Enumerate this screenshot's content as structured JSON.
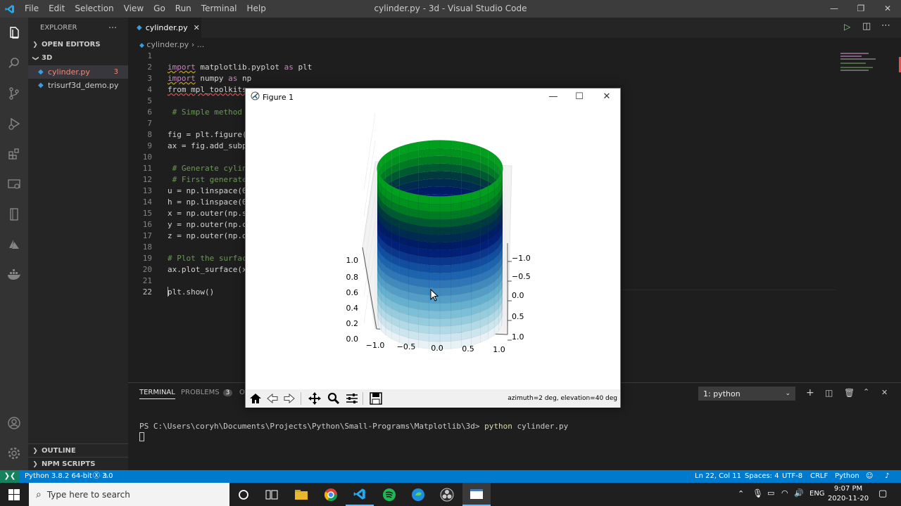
{
  "app": {
    "window_title": "cylinder.py - 3d - Visual Studio Code",
    "menu": [
      "File",
      "Edit",
      "Selection",
      "View",
      "Go",
      "Run",
      "Terminal",
      "Help"
    ]
  },
  "sidebar": {
    "title": "EXPLORER",
    "open_editors": "OPEN EDITORS",
    "folder": "3D",
    "files": [
      {
        "name": "cylinder.py",
        "problems": "3"
      },
      {
        "name": "trisurf3d_demo.py"
      }
    ],
    "outline": "OUTLINE",
    "npm_scripts": "NPM SCRIPTS"
  },
  "editor": {
    "tab_label": "cylinder.py",
    "breadcrumb_file": "cylinder.py",
    "breadcrumb_rest": "...",
    "lines": [
      {
        "n": "1",
        "t": ""
      },
      {
        "n": "2",
        "t": "import matplotlib.pyplot as plt"
      },
      {
        "n": "3",
        "t": "import numpy as np"
      },
      {
        "n": "4",
        "t": "from mpl_toolkits"
      },
      {
        "n": "5",
        "t": ""
      },
      {
        "n": "6",
        "t": " # Simple method"
      },
      {
        "n": "7",
        "t": ""
      },
      {
        "n": "8",
        "t": "fig = plt.figure("
      },
      {
        "n": "9",
        "t": "ax = fig.add_subp"
      },
      {
        "n": "10",
        "t": ""
      },
      {
        "n": "11",
        "t": " # Generate cylin"
      },
      {
        "n": "12",
        "t": " # First generate"
      },
      {
        "n": "13",
        "t": "u = np.linspace(0"
      },
      {
        "n": "14",
        "t": "h = np.linspace(0"
      },
      {
        "n": "15",
        "t": "x = np.outer(np.s"
      },
      {
        "n": "16",
        "t": "y = np.outer(np.c"
      },
      {
        "n": "17",
        "t": "z = np.outer(np.o"
      },
      {
        "n": "18",
        "t": ""
      },
      {
        "n": "19",
        "t": "# Plot the surfac"
      },
      {
        "n": "20",
        "t": "ax.plot_surface(x"
      },
      {
        "n": "21",
        "t": ""
      },
      {
        "n": "22",
        "t": "plt.show()"
      }
    ]
  },
  "panel": {
    "tabs": {
      "terminal": "TERMINAL",
      "problems": "PROBLEMS",
      "problems_count": "3",
      "output": "O"
    },
    "terminal_select": "1: python",
    "prompt": "PS C:\\Users\\coryh\\Documents\\Projects\\Python\\Small-Programs\\Matplotlib\\3d>",
    "command": "python",
    "command_arg": "cylinder.py"
  },
  "statusbar": {
    "python": "Python 3.8.2 64-bit",
    "errors": "3",
    "warnings": "0",
    "position": "Ln 22, Col 11",
    "spaces": "Spaces: 4",
    "encoding": "UTF-8",
    "eol": "CRLF",
    "language": "Python"
  },
  "taskbar": {
    "search_placeholder": "Type here to search",
    "lang": "ENG",
    "time": "9:07 PM",
    "date": "2020-11-20"
  },
  "figure": {
    "title": "Figure 1",
    "status": "azimuth=2 deg, elevation=40 deg"
  },
  "chart_data": {
    "type": "surface3d",
    "x_ticks": [
      "−1.0",
      "−0.5",
      "0.0",
      "0.5",
      "1.0"
    ],
    "y_ticks": [
      "−1.0",
      "−0.5",
      "0.0",
      "0.5",
      "1.0"
    ],
    "z_ticks": [
      "0.0",
      "0.2",
      "0.4",
      "0.6",
      "0.8",
      "1.0"
    ],
    "xlim": [
      -1,
      1
    ],
    "ylim": [
      -1,
      1
    ],
    "zlim": [
      0,
      1
    ],
    "surface": "cylinder radius 1, height 1",
    "colormap": "ocean"
  }
}
